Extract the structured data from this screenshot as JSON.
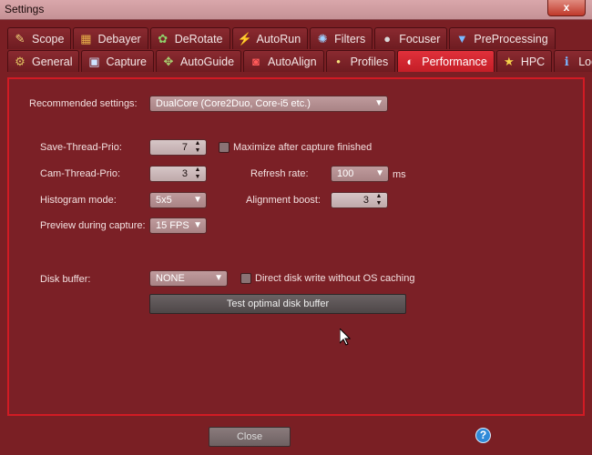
{
  "window": {
    "title": "Settings",
    "close_glyph": "x"
  },
  "tabs_row1": [
    {
      "label": "Scope",
      "icon": "telescope-icon",
      "glyph": "✎"
    },
    {
      "label": "Debayer",
      "icon": "color-grid-icon",
      "glyph": "▦"
    },
    {
      "label": "DeRotate",
      "icon": "derotate-icon",
      "glyph": "✿"
    },
    {
      "label": "AutoRun",
      "icon": "autorun-icon",
      "glyph": "⚡"
    },
    {
      "label": "Filters",
      "icon": "filters-icon",
      "glyph": "✺"
    },
    {
      "label": "Focuser",
      "icon": "focuser-icon",
      "glyph": "●"
    },
    {
      "label": "PreProcessing",
      "icon": "funnel-icon",
      "glyph": "▼"
    }
  ],
  "tabs_row2": [
    {
      "label": "General",
      "icon": "gear-icon",
      "glyph": "⚙"
    },
    {
      "label": "Capture",
      "icon": "camera-icon",
      "glyph": "▣"
    },
    {
      "label": "AutoGuide",
      "icon": "crosshair-icon",
      "glyph": "✥"
    },
    {
      "label": "AutoAlign",
      "icon": "target-icon",
      "glyph": "◙"
    },
    {
      "label": "Profiles",
      "icon": "dot-icon",
      "glyph": "•"
    },
    {
      "label": "Performance",
      "icon": "speedometer-icon",
      "glyph": "◐",
      "active": true
    },
    {
      "label": "HPC",
      "icon": "star-icon",
      "glyph": "★"
    },
    {
      "label": "Log",
      "icon": "info-icon",
      "glyph": "ℹ"
    }
  ],
  "performance": {
    "recommended_label": "Recommended settings:",
    "recommended_value": "DualCore (Core2Duo, Core-i5 etc.)",
    "save_thread_label": "Save-Thread-Prio:",
    "save_thread_value": "7",
    "maximize_label": "Maximize after capture finished",
    "cam_thread_label": "Cam-Thread-Prio:",
    "cam_thread_value": "3",
    "refresh_label": "Refresh rate:",
    "refresh_value": "100",
    "refresh_unit": "ms",
    "histogram_label": "Histogram mode:",
    "histogram_value": "5x5",
    "alignment_label": "Alignment boost:",
    "alignment_value": "3",
    "preview_label": "Preview during capture:",
    "preview_value": "15 FPS",
    "disk_buffer_label": "Disk buffer:",
    "disk_buffer_value": "NONE",
    "direct_write_label": "Direct disk write without OS caching",
    "test_button": "Test optimal disk buffer"
  },
  "footer": {
    "close_label": "Close",
    "help_glyph": "?"
  },
  "colors": {
    "background": "#7a1f24",
    "active_tab": "#c41e27",
    "panel_border": "#d11b24"
  }
}
